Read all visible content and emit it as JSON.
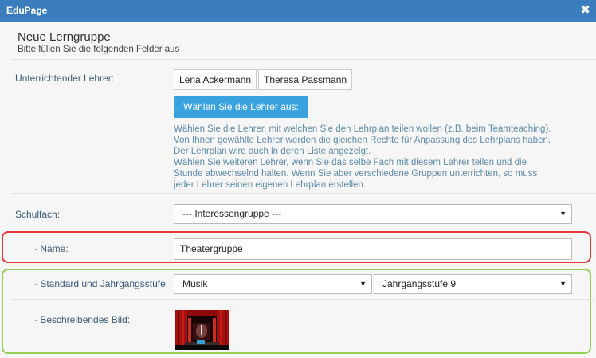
{
  "window": {
    "title": "EduPage",
    "close_glyph": "✖"
  },
  "form": {
    "heading": "Neue Lerngruppe",
    "subheading": "Bitte füllen Sie die folgenden Felder aus"
  },
  "teachers": {
    "label": "Unterrichtender Lehrer:",
    "selected": [
      "Lena Ackermann",
      "Theresa Passmann"
    ],
    "choose_button": "Wählen Sie die Lehrer aus:",
    "help_lines": [
      "Wählen Sie die Lehrer, mit welchen Sie den Lehrplan teilen wollen (z.B. beim Teamteaching).",
      "Von Ihnen gewählte Lehrer werden die gleichen Rechte für Anpassung des Lehrplans haben.",
      "Der Lehrplan wird auch in deren Liste angezeigt.",
      "Wählen Sie weiteren Lehrer, wenn Sie das selbe Fach mit diesem Lehrer teilen und die",
      "Stunde abwechselnd halten. Wenn Sie aber verschiedene Gruppen unterrichten, so muss",
      "jeder Lehrer seinen eigenen Lehrplan erstellen."
    ]
  },
  "subject": {
    "label": "Schulfach:",
    "value": "--- Interessengruppe ---"
  },
  "name": {
    "label": "- Name:",
    "value": "Theatergruppe"
  },
  "standard": {
    "label": "- Standard und Jahrgangsstufe:",
    "subject_value": "Musik",
    "grade_value": "Jahrgangsstufe 9"
  },
  "image": {
    "label": "- Beschreibendes Bild:",
    "icon": "theater-stage-image"
  },
  "colors": {
    "titlebar": "#3a7ebd",
    "button": "#3aa3df",
    "help_text": "#5e8aa8",
    "highlight_red": "#e53a3a",
    "highlight_green": "#93cf55"
  }
}
